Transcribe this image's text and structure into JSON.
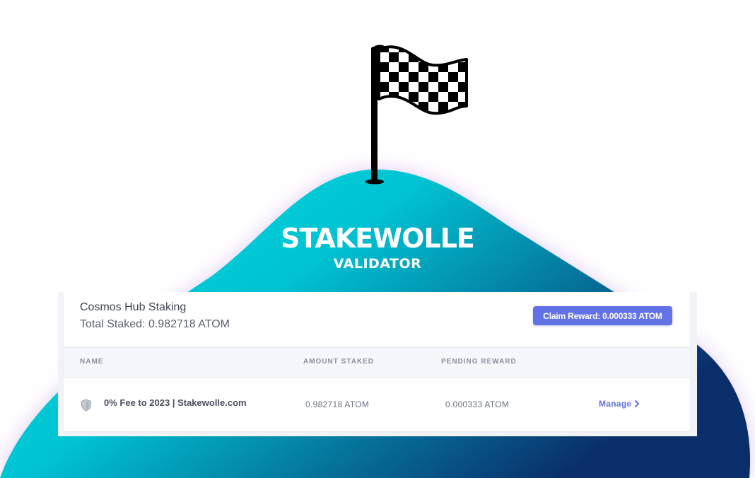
{
  "hero": {
    "title": "STAKEWOLLE",
    "subtitle": "VALIDATOR",
    "gradient_colors": [
      "#00e0e0",
      "#00b4c8",
      "#0a2f6a"
    ],
    "icon": "checkered-flag-icon"
  },
  "staking_card": {
    "title": "Cosmos Hub Staking",
    "total_staked": "Total Staked: 0.982718 ATOM",
    "claim_button": "Claim Reward: 0.000333 ATOM",
    "accent_color": "#6272e6",
    "columns": [
      "NAME",
      "AMOUNT STAKED",
      "PENDING REWARD"
    ],
    "rows": [
      {
        "icon": "shield-icon",
        "name": "0% Fee to 2023 | Stakewolle.com",
        "amount_staked": "0.982718 ATOM",
        "pending_reward": "0.000333 ATOM",
        "action": "Manage"
      }
    ]
  }
}
